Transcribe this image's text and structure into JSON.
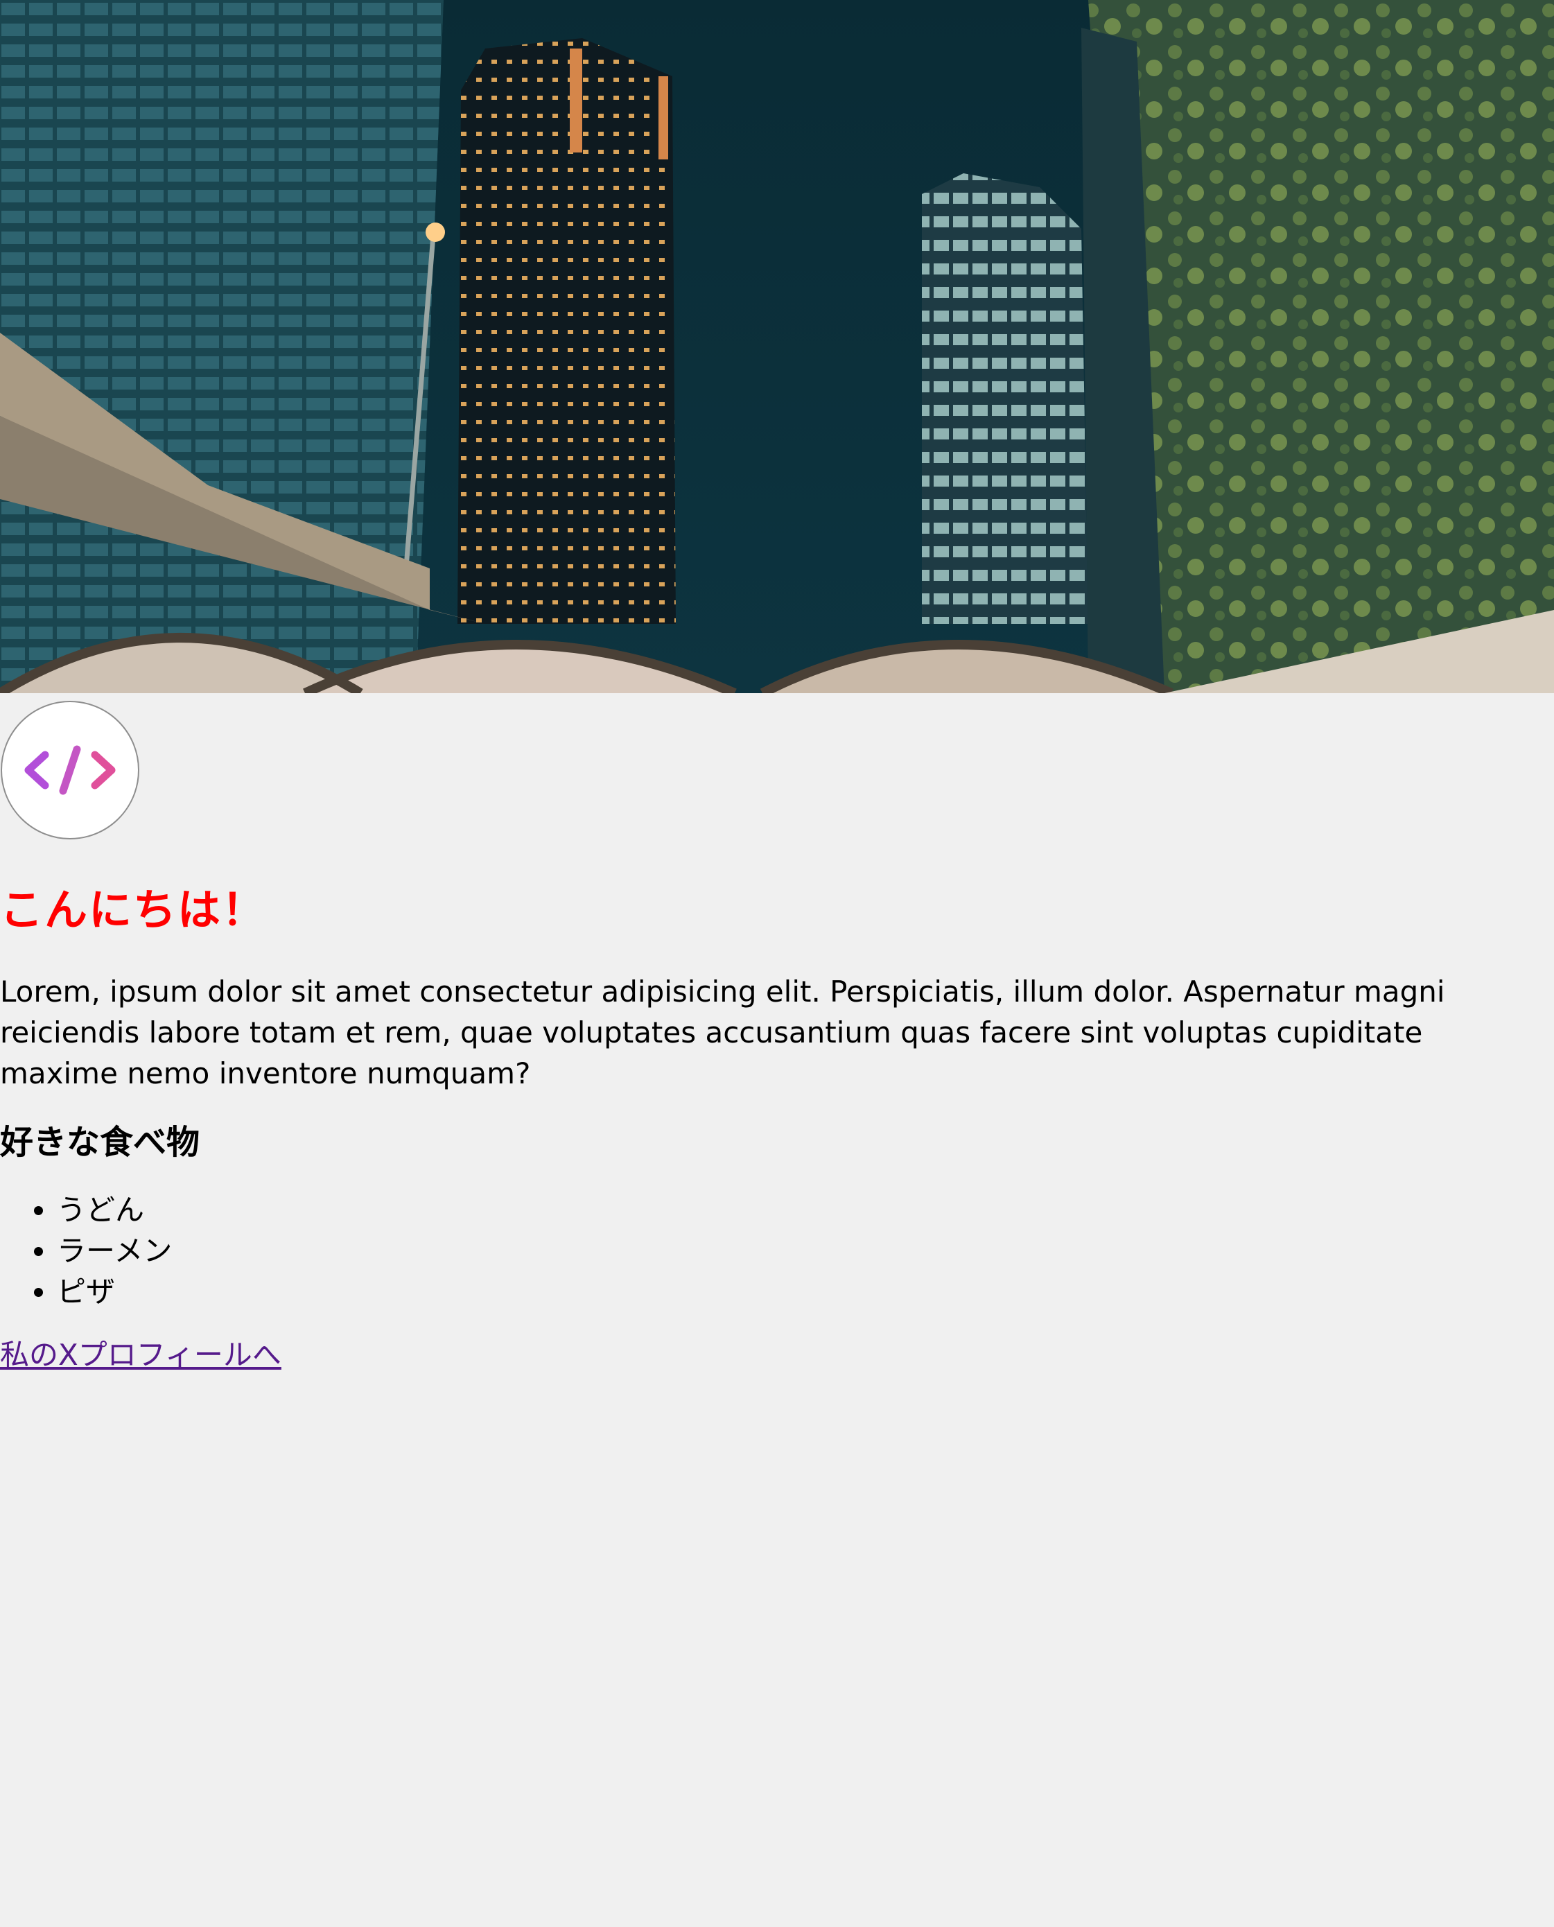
{
  "hero": {
    "icon": "city-night-photo"
  },
  "logo": {
    "icon": "code-brackets-icon",
    "colors": {
      "left": "#b24fd9",
      "slash": "#c456c4",
      "right": "#e0509b"
    }
  },
  "heading": "こんにちは！",
  "intro": "Lorem, ipsum dolor sit amet consectetur adipisicing elit. Perspiciatis, illum dolor. Aspernatur magni reiciendis labore totam et rem, quae voluptates accusantium quas facere sint voluptas cupiditate maxime nemo inventore numquam?",
  "favorites": {
    "title": "好きな食べ物",
    "items": [
      "うどん",
      "ラーメン",
      "ピザ"
    ]
  },
  "link": {
    "label": "私のXプロフィールへ"
  },
  "colors": {
    "background": "#f0f0f0",
    "heading": "#ff0000",
    "link": "#551a8b"
  }
}
